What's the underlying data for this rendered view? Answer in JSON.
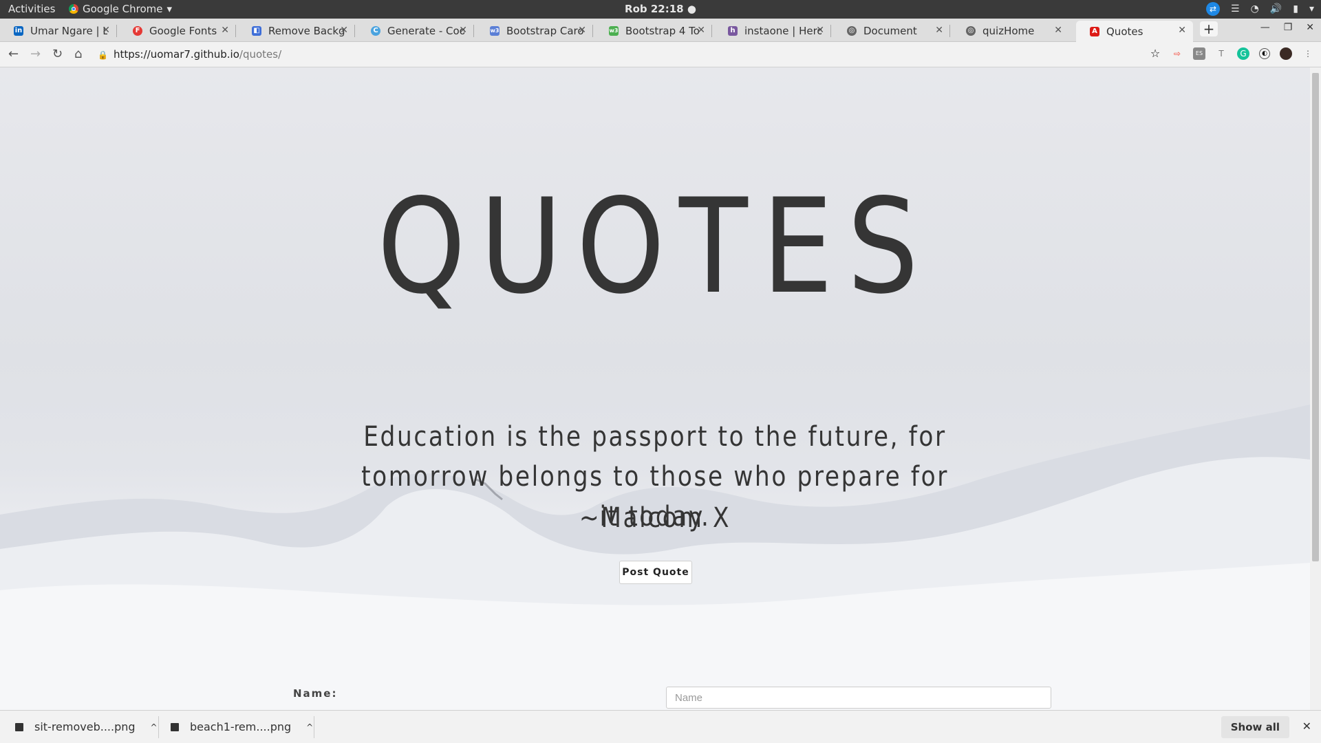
{
  "system_bar": {
    "activities": "Activities",
    "app_name": "Google Chrome",
    "clock": "Rob 22:18"
  },
  "tabs": [
    {
      "title": "Umar Ngare | Li",
      "favicon": "linkedin-icon",
      "color": "#0a66c2",
      "active": false
    },
    {
      "title": "Google Fonts",
      "favicon": "google-fonts-icon",
      "color": "#e53935",
      "active": false
    },
    {
      "title": "Remove Backgr",
      "favicon": "remove-bg-icon",
      "color": "#3f6fd8",
      "active": false
    },
    {
      "title": "Generate - Cool",
      "favicon": "coolors-icon",
      "color": "#4aa3df",
      "active": false
    },
    {
      "title": "Bootstrap Caro",
      "favicon": "w3schools-icon",
      "color": "#5b7fd6",
      "active": false
    },
    {
      "title": "Bootstrap 4 To",
      "favicon": "w3schools-icon",
      "color": "#4caf50",
      "active": false
    },
    {
      "title": "instaone | Hero",
      "favicon": "heroku-icon",
      "color": "#79589f",
      "active": false
    },
    {
      "title": "Document",
      "favicon": "globe-icon",
      "color": "#666666",
      "active": false
    },
    {
      "title": "quizHome",
      "favicon": "globe-icon",
      "color": "#666666",
      "active": false
    },
    {
      "title": "Quotes",
      "favicon": "angular-icon",
      "color": "#dd1b16",
      "active": true
    }
  ],
  "address": {
    "host": "https://uomar7.github.io",
    "path": "/quotes/"
  },
  "page": {
    "title": "QUOTES",
    "quote_text": "Education is the passport to the future, for tomorrow belongs to those who prepare for it today.",
    "quote_author": "~Malcom X",
    "post_button": "Post Quote",
    "name_label": "Name:",
    "name_placeholder": "Name",
    "name_value": ""
  },
  "downloads": {
    "items": [
      "sit-removeb....png",
      "beach1-rem....png"
    ],
    "show_all": "Show all"
  }
}
